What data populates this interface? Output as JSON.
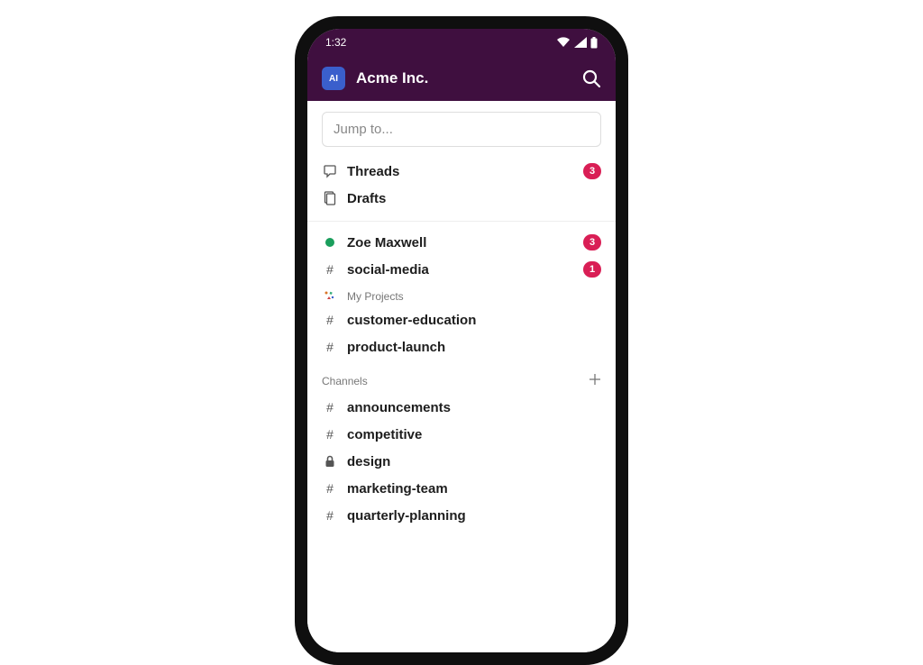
{
  "status": {
    "time": "1:32"
  },
  "header": {
    "workspace_initials": "AI",
    "workspace_name": "Acme Inc."
  },
  "search": {
    "placeholder": "Jump to..."
  },
  "top_items": {
    "threads": {
      "label": "Threads",
      "badge": "3"
    },
    "drafts": {
      "label": "Drafts"
    }
  },
  "unread_section": {
    "dm": {
      "label": "Zoe Maxwell",
      "badge": "3"
    },
    "channel": {
      "label": "social-media",
      "badge": "1"
    }
  },
  "my_projects": {
    "title": "My Projects",
    "items": [
      {
        "label": "customer-education"
      },
      {
        "label": "product-launch"
      }
    ]
  },
  "channels_section": {
    "title": "Channels",
    "items": [
      {
        "label": "announcements",
        "locked": false
      },
      {
        "label": "competitive",
        "locked": false
      },
      {
        "label": "design",
        "locked": true
      },
      {
        "label": "marketing-team",
        "locked": false
      },
      {
        "label": "quarterly-planning",
        "locked": false
      }
    ]
  }
}
